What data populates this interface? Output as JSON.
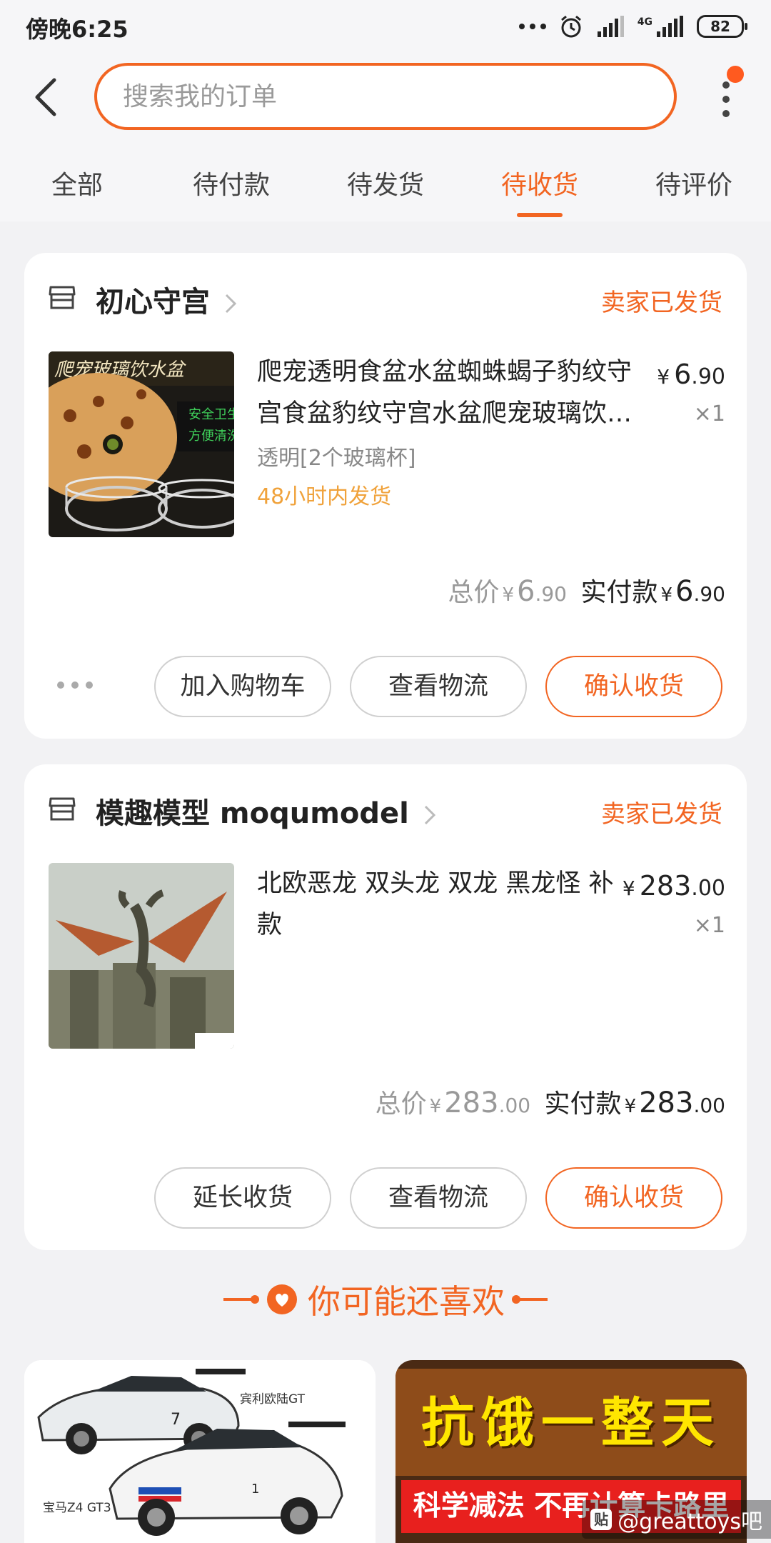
{
  "status_bar": {
    "time": "傍晚6:25",
    "network": "4G",
    "battery": "82"
  },
  "search": {
    "placeholder": "搜索我的订单"
  },
  "tabs": [
    {
      "label": "全部"
    },
    {
      "label": "待付款"
    },
    {
      "label": "待发货"
    },
    {
      "label": "待收货",
      "active": true
    },
    {
      "label": "待评价"
    }
  ],
  "orders": [
    {
      "shop": "初心守宫",
      "status": "卖家已发货",
      "title": "爬宠透明食盆水盆蜘蛛蝎子豹纹守宫食盆豹纹守宫水盆爬宠玻璃饮水盆",
      "sku": "透明[2个玻璃杯]",
      "ship_note": "48小时内发货",
      "price_int": "6",
      "price_dec": ".90",
      "qty": "×1",
      "total_label": "总价",
      "total_int": "6",
      "total_dec": ".90",
      "paid_label": "实付款",
      "paid_int": "6",
      "paid_dec": ".90",
      "buttons": [
        "加入购物车",
        "查看物流",
        "确认收货"
      ]
    },
    {
      "shop": "模趣模型 moqumodel",
      "status": "卖家已发货",
      "title": "北欧恶龙 双头龙 双龙  黑龙怪 补款",
      "price_int": "283",
      "price_dec": ".00",
      "qty": "×1",
      "total_label": "总价",
      "total_int": "283",
      "total_dec": ".00",
      "paid_label": "实付款",
      "paid_int": "283",
      "paid_dec": ".00",
      "buttons": [
        "延长收货",
        "查看物流",
        "确认收货"
      ]
    }
  ],
  "currency": "¥",
  "recommend": {
    "heading": "你可能还喜欢",
    "left_card": {
      "label_top": "宾利欧陆GT",
      "label_bottom": "宝马Z4 GT3"
    },
    "right_card": {
      "title": "抗饿一整天",
      "subtitle": "科学减法 不再计算卡路里"
    }
  },
  "thumb1_text": {
    "banner": "爬宠玻璃饮水盆",
    "side1": "安全卫生",
    "side2": "方便清洗"
  },
  "watermark": {
    "badge": "贴",
    "text": "@greattoys吧"
  },
  "colors": {
    "accent": "#f26522",
    "ship_note": "#f0a23b",
    "background": "#f2f2f4"
  }
}
